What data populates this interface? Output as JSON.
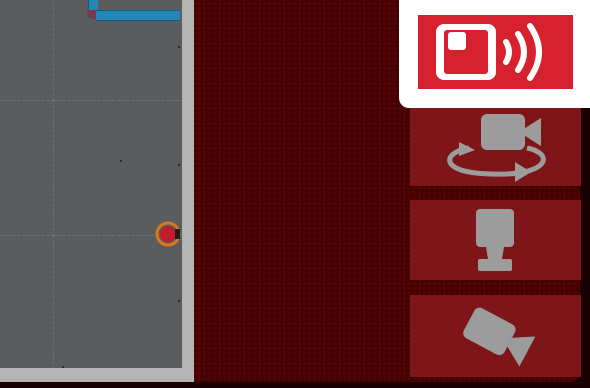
{
  "app": {
    "view": "camera-control-panel"
  },
  "colors": {
    "background": "#4b0000",
    "floor_border": "#b4b4b4",
    "floor": "#5b5c5e",
    "wall": "#2287b8",
    "panel_button": "#7d1519",
    "active_camera_card": "#d8212f",
    "icon": "#9c9c9c",
    "robot": "#c21c2a",
    "robot_ring": "#d67a1a"
  },
  "panel": {
    "buttons": [
      {
        "name": "camera-sensor",
        "icon": "camera-sensor-signal-icon",
        "active": true
      },
      {
        "name": "orbit-camera",
        "icon": "camera-orbit-icon",
        "active": false
      },
      {
        "name": "top-down-camera",
        "icon": "camera-topdown-icon",
        "active": false
      },
      {
        "name": "follow-camera",
        "icon": "video-camera-icon",
        "active": false
      }
    ]
  }
}
